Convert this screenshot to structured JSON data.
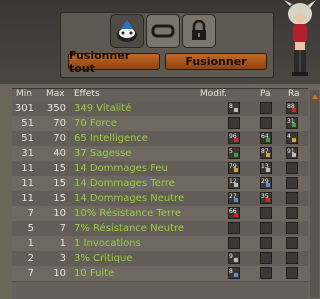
{
  "buttons": {
    "fusionner_tout": "Fusionner tout",
    "fusionner": "Fusionner"
  },
  "headers": {
    "min": "Min",
    "max": "Max",
    "effets": "Effets",
    "modif": "Modif.",
    "pa": "Pa",
    "ra": "Ra"
  },
  "rows": [
    {
      "min": "301",
      "max": "350",
      "effet": "349 Vitalité",
      "modif": "8",
      "pa": "",
      "ra": "88"
    },
    {
      "min": "51",
      "max": "70",
      "effet": "70 Force",
      "modif": "",
      "pa": "",
      "ra": "31"
    },
    {
      "min": "51",
      "max": "70",
      "effet": "65 Intelligence",
      "modif": "96",
      "pa": "64",
      "ra": "4"
    },
    {
      "min": "31",
      "max": "40",
      "effet": "37 Sagesse",
      "modif": "5",
      "pa": "87",
      "ra": "91"
    },
    {
      "min": "11",
      "max": "15",
      "effet": "14 Dommages Feu",
      "modif": "79",
      "pa": "13",
      "ra": ""
    },
    {
      "min": "11",
      "max": "15",
      "effet": "14 Dommages Terre",
      "modif": "12",
      "pa": "29",
      "ra": ""
    },
    {
      "min": "11",
      "max": "15",
      "effet": "14 Dommages Neutre",
      "modif": "27",
      "pa": "35",
      "ra": ""
    },
    {
      "min": "7",
      "max": "10",
      "effet": "10% Résistance Terre",
      "modif": "66",
      "pa": "",
      "ra": ""
    },
    {
      "min": "5",
      "max": "7",
      "effet": "7% Résistance Neutre",
      "modif": "",
      "pa": "",
      "ra": ""
    },
    {
      "min": "1",
      "max": "1",
      "effet": "1 Invocations",
      "modif": "",
      "pa": "",
      "ra": ""
    },
    {
      "min": "2",
      "max": "3",
      "effet": "3% Critique",
      "modif": "9",
      "pa": "",
      "ra": ""
    },
    {
      "min": "7",
      "max": "10",
      "effet": "10 Fuite",
      "modif": "8",
      "pa": "",
      "ra": ""
    }
  ]
}
